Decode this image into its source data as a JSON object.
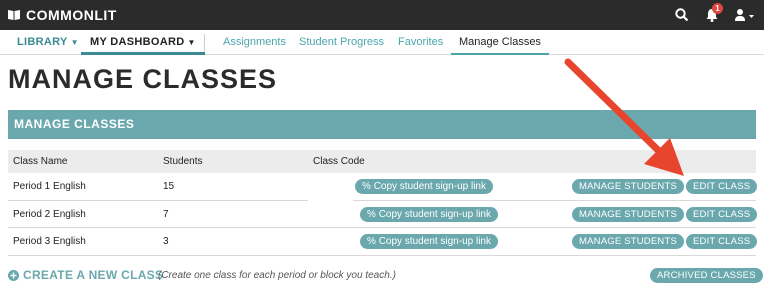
{
  "topbar": {
    "logo_bold": "COMMON",
    "logo_rest": "LIT",
    "notification_count": "1"
  },
  "subnav": {
    "library": "LIBRARY",
    "dashboard": "MY DASHBOARD",
    "links": [
      "Assignments",
      "Student Progress",
      "Favorites",
      "Manage Classes"
    ]
  },
  "page_title": "MANAGE CLASSES",
  "panel_title": "MANAGE CLASSES",
  "table": {
    "headers": [
      "Class Name",
      "Students",
      "Class Code"
    ],
    "rows": [
      {
        "name": "Period 1 English",
        "students": "15"
      },
      {
        "name": "Period 2 English",
        "students": "7"
      },
      {
        "name": "Period 3 English",
        "students": "3"
      }
    ],
    "copy_label": "Copy student sign-up link",
    "manage_label": "MANAGE STUDENTS",
    "edit_label": "EDIT CLASS"
  },
  "footer": {
    "create_label": "CREATE A NEW CLASS",
    "create_note": "(Create one class for each period or block you teach.)",
    "archived_label": "ARCHIVED CLASSES"
  },
  "colors": {
    "accent": "#6aa8ae",
    "topbar": "#2b2b2b",
    "annotation_arrow": "#e8452e"
  },
  "icons": [
    "book-icon",
    "search-icon",
    "bell-icon",
    "user-icon",
    "link-icon",
    "plus-circle-icon",
    "arrow-annotation"
  ]
}
